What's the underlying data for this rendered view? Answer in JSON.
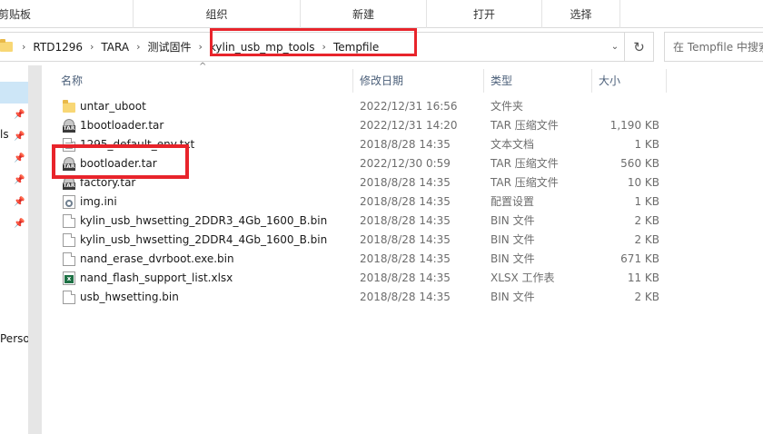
{
  "ribbon": {
    "groups": [
      "剪贴板",
      "组织",
      "新建",
      "打开",
      "选择"
    ]
  },
  "address": {
    "crumbs": [
      "RTD1296",
      "TARA",
      "测试固件",
      "kylin_usb_mp_tools",
      "Tempfile"
    ],
    "refresh_icon": "refresh-icon",
    "search_placeholder": "在 Tempfile 中搜索"
  },
  "nav": {
    "fragment_1": "ls",
    "fragment_2": "Perso"
  },
  "columns": {
    "name": "名称",
    "date": "修改日期",
    "type": "类型",
    "size": "大小"
  },
  "files": [
    {
      "icon": "folder-icon",
      "name": "untar_uboot",
      "date": "2022/12/31 16:56",
      "type": "文件夹",
      "size": ""
    },
    {
      "icon": "tar-archive-icon",
      "name": "1bootloader.tar",
      "date": "2022/12/31 14:20",
      "type": "TAR 压缩文件",
      "size": "1,190 KB"
    },
    {
      "icon": "text-file-icon",
      "name": "1295_default_env.txt",
      "date": "2018/8/28 14:35",
      "type": "文本文档",
      "size": "1 KB"
    },
    {
      "icon": "tar-archive-icon",
      "name": "bootloader.tar",
      "date": "2022/12/30 0:59",
      "type": "TAR 压缩文件",
      "size": "560 KB"
    },
    {
      "icon": "tar-archive-icon",
      "name": "factory.tar",
      "date": "2018/8/28 14:35",
      "type": "TAR 压缩文件",
      "size": "10 KB"
    },
    {
      "icon": "config-file-icon",
      "name": "img.ini",
      "date": "2018/8/28 14:35",
      "type": "配置设置",
      "size": "1 KB"
    },
    {
      "icon": "file-icon",
      "name": "kylin_usb_hwsetting_2DDR3_4Gb_1600_B.bin",
      "date": "2018/8/28 14:35",
      "type": "BIN 文件",
      "size": "2 KB"
    },
    {
      "icon": "file-icon",
      "name": "kylin_usb_hwsetting_2DDR4_4Gb_1600_B.bin",
      "date": "2018/8/28 14:35",
      "type": "BIN 文件",
      "size": "2 KB"
    },
    {
      "icon": "file-icon",
      "name": "nand_erase_dvrboot.exe.bin",
      "date": "2018/8/28 14:35",
      "type": "BIN 文件",
      "size": "671 KB"
    },
    {
      "icon": "excel-file-icon",
      "name": "nand_flash_support_list.xlsx",
      "date": "2018/8/28 14:35",
      "type": "XLSX 工作表",
      "size": "11 KB"
    },
    {
      "icon": "file-icon",
      "name": "usb_hwsetting.bin",
      "date": "2018/8/28 14:35",
      "type": "BIN 文件",
      "size": "2 KB"
    }
  ],
  "colors": {
    "highlight": "#e8242b",
    "header_text": "#4c607a",
    "selection": "#cde6f7"
  }
}
